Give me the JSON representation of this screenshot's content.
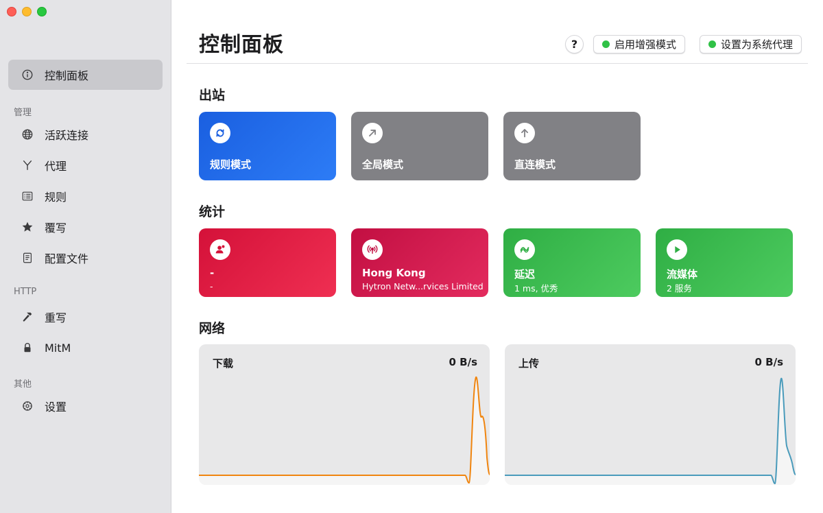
{
  "sidebar": {
    "items": [
      {
        "label": "控制面板",
        "icon": "info-circle-icon"
      },
      {
        "label": "活跃连接",
        "icon": "globe-icon"
      },
      {
        "label": "代理",
        "icon": "branch-icon"
      },
      {
        "label": "规则",
        "icon": "list-icon"
      },
      {
        "label": "覆写",
        "icon": "star-icon"
      },
      {
        "label": "配置文件",
        "icon": "document-icon"
      },
      {
        "label": "重写",
        "icon": "hammer-icon"
      },
      {
        "label": "MitM",
        "icon": "lock-icon"
      },
      {
        "label": "设置",
        "icon": "gear-icon"
      }
    ],
    "sections": {
      "manage": "管理",
      "http": "HTTP",
      "other": "其他"
    }
  },
  "header": {
    "title": "控制面板",
    "help_label": "?",
    "enhanced_mode_label": "启用增强模式",
    "system_proxy_label": "设置为系统代理"
  },
  "outbound": {
    "title": "出站",
    "modes": [
      {
        "label": "规则模式",
        "icon": "rule-mode-icon"
      },
      {
        "label": "全局模式",
        "icon": "arrow-up-right-icon"
      },
      {
        "label": "直连模式",
        "icon": "arrow-up-icon"
      }
    ]
  },
  "stats": {
    "title": "统计",
    "cards": [
      {
        "title": "-",
        "subtitle": "-",
        "icon": "user-alert-icon"
      },
      {
        "title": "Hong Kong",
        "subtitle": "Hytron Netw...rvices Limited",
        "icon": "antenna-icon"
      },
      {
        "title": "延迟",
        "subtitle": "1 ms, 优秀",
        "icon": "wave-icon"
      },
      {
        "title": "流媒体",
        "subtitle": "2 服务",
        "icon": "play-icon"
      }
    ]
  },
  "network": {
    "title": "网络",
    "download": {
      "label": "下载",
      "rate": "0 B/s"
    },
    "upload": {
      "label": "上传",
      "rate": "0 B/s"
    }
  },
  "colors": {
    "accent_blue": "#1a5fe0",
    "download_line": "#f0850f",
    "upload_line": "#4a9bbb",
    "status_green": "#30c146"
  }
}
